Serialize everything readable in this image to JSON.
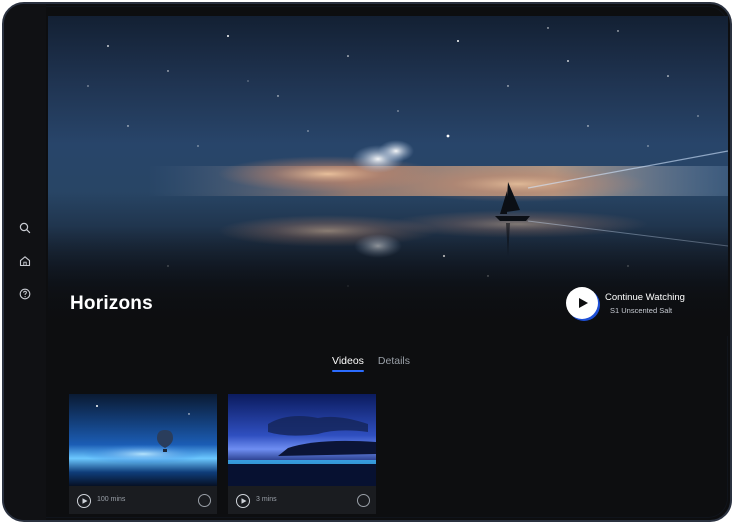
{
  "sidebar": {
    "items": [
      {
        "icon": "search-icon"
      },
      {
        "icon": "home-icon"
      },
      {
        "icon": "help-icon"
      }
    ]
  },
  "hero": {
    "title": "Horizons",
    "continue_label": "Continue Watching",
    "continue_sub": "S1 Unscented Salt"
  },
  "tabs": [
    {
      "label": "Videos",
      "active": true
    },
    {
      "label": "Details",
      "active": false
    }
  ],
  "videos": [
    {
      "duration": "100 mins"
    },
    {
      "duration": "3 mins"
    }
  ],
  "colors": {
    "accent": "#2b6cff",
    "background": "#0d0e10",
    "sidebar": "#101114"
  }
}
